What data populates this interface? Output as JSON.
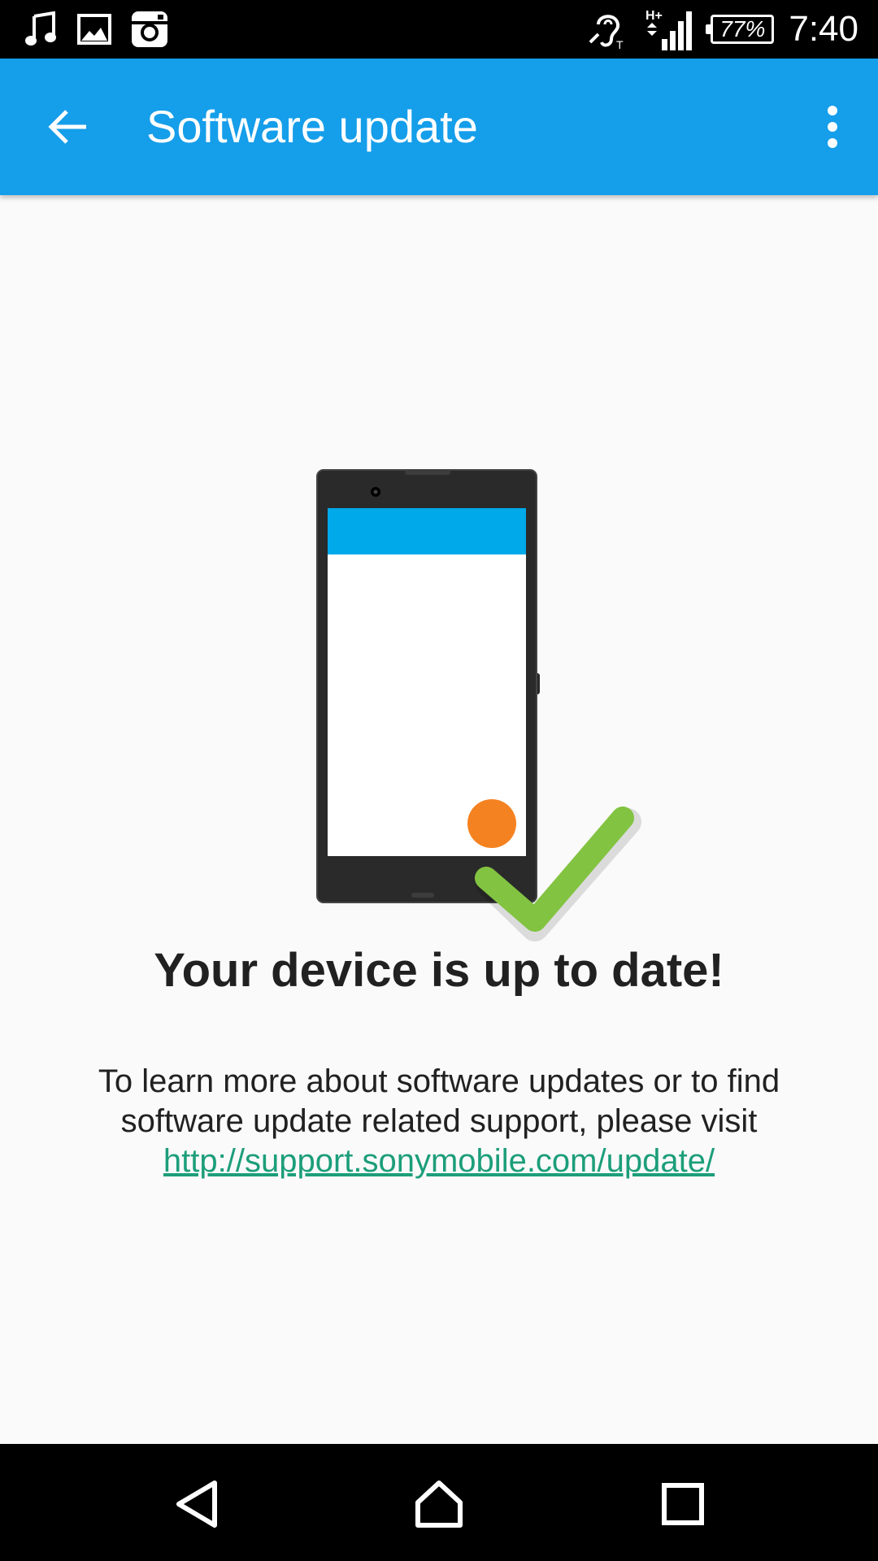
{
  "status_bar": {
    "left_icons": [
      "music-note-icon",
      "image-icon",
      "instagram-icon"
    ],
    "right_icons": [
      "hearing-aid-tty-icon",
      "signal-hplus-icon"
    ],
    "network_label": "H+",
    "battery_percent": "77%",
    "time": "7:40"
  },
  "app_bar": {
    "title": "Software update",
    "back_icon": "arrow-back-icon",
    "overflow_icon": "more-vert-icon",
    "color": "#159eea"
  },
  "illustration": {
    "description_icon": "phone-with-checkmark-icon",
    "colors": {
      "phone_body": "#2a2a2a",
      "screen_header": "#00a9ea",
      "fab": "#f58220",
      "checkmark": "#82c341"
    }
  },
  "main": {
    "headline": "Your device is up to date!",
    "body_line1": "To learn more about software updates or to find",
    "body_line2": "software update related support, please visit",
    "link": "http://support.sonymobile.com/update/"
  },
  "nav_bar": {
    "back": "nav-back-icon",
    "home": "nav-home-icon",
    "recents": "nav-recents-icon"
  }
}
